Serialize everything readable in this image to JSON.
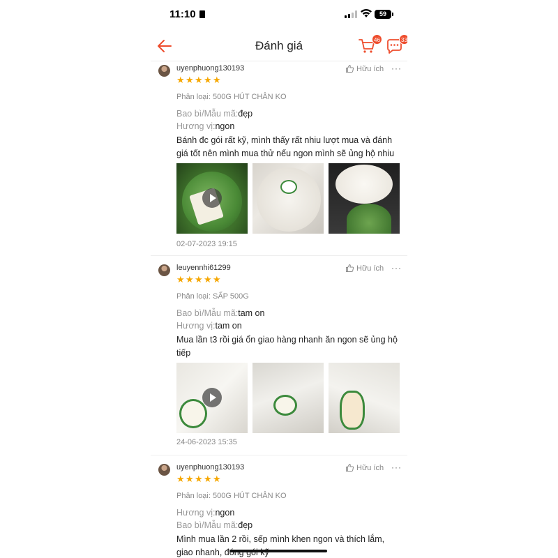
{
  "status_bar": {
    "time": "11:10",
    "battery": "59"
  },
  "header": {
    "title": "Đánh giá",
    "cart_badge": "46",
    "chat_badge": "33"
  },
  "reviews": [
    {
      "username": "uyenphuong130193",
      "helpful_label": "Hữu ích",
      "more": "···",
      "rating": 5,
      "variant": "Phân loại: 500G HÚT CHÂN KO",
      "attrs": [
        {
          "label": "Bao bì/Mẫu mã:",
          "value": "đẹp"
        },
        {
          "label": "Hương vị:",
          "value": "ngon"
        }
      ],
      "comment": "Bánh đc gói rất kỹ, mình thấy rất nhiu lượt mua và đánh giá tốt nên mình mua thử nếu ngon mình sẽ ủng hộ nhiu",
      "date": "02-07-2023 19:15"
    },
    {
      "username": "leuyennhi61299",
      "helpful_label": "Hữu ích",
      "more": "···",
      "rating": 5,
      "variant": "Phân loại: SẤP 500G",
      "attrs": [
        {
          "label": "Bao bì/Mẫu mã:",
          "value": "tam on"
        },
        {
          "label": "Hương vị:",
          "value": "tam on"
        }
      ],
      "comment": "Mua lần t3 rồi giá ổn giao hàng nhanh ăn ngon sẽ ủng hộ tiếp",
      "date": "24-06-2023 15:35"
    },
    {
      "username": "uyenphuong130193",
      "helpful_label": "Hữu ích",
      "more": "···",
      "rating": 5,
      "variant": "Phân loại: 500G HÚT CHÂN KO",
      "attrs": [
        {
          "label": "Hương vị:",
          "value": "ngon"
        },
        {
          "label": "Bao bì/Mẫu mã:",
          "value": "đẹp"
        }
      ],
      "comment": "Mình mua lần 2 rồi, sếp mình khen ngon và thích lắm, giao nhanh, đóng gói kỹ",
      "date": ""
    }
  ],
  "star_glyph": "★",
  "colors": {
    "accent": "#ee4d2d",
    "star": "#f6a700"
  }
}
